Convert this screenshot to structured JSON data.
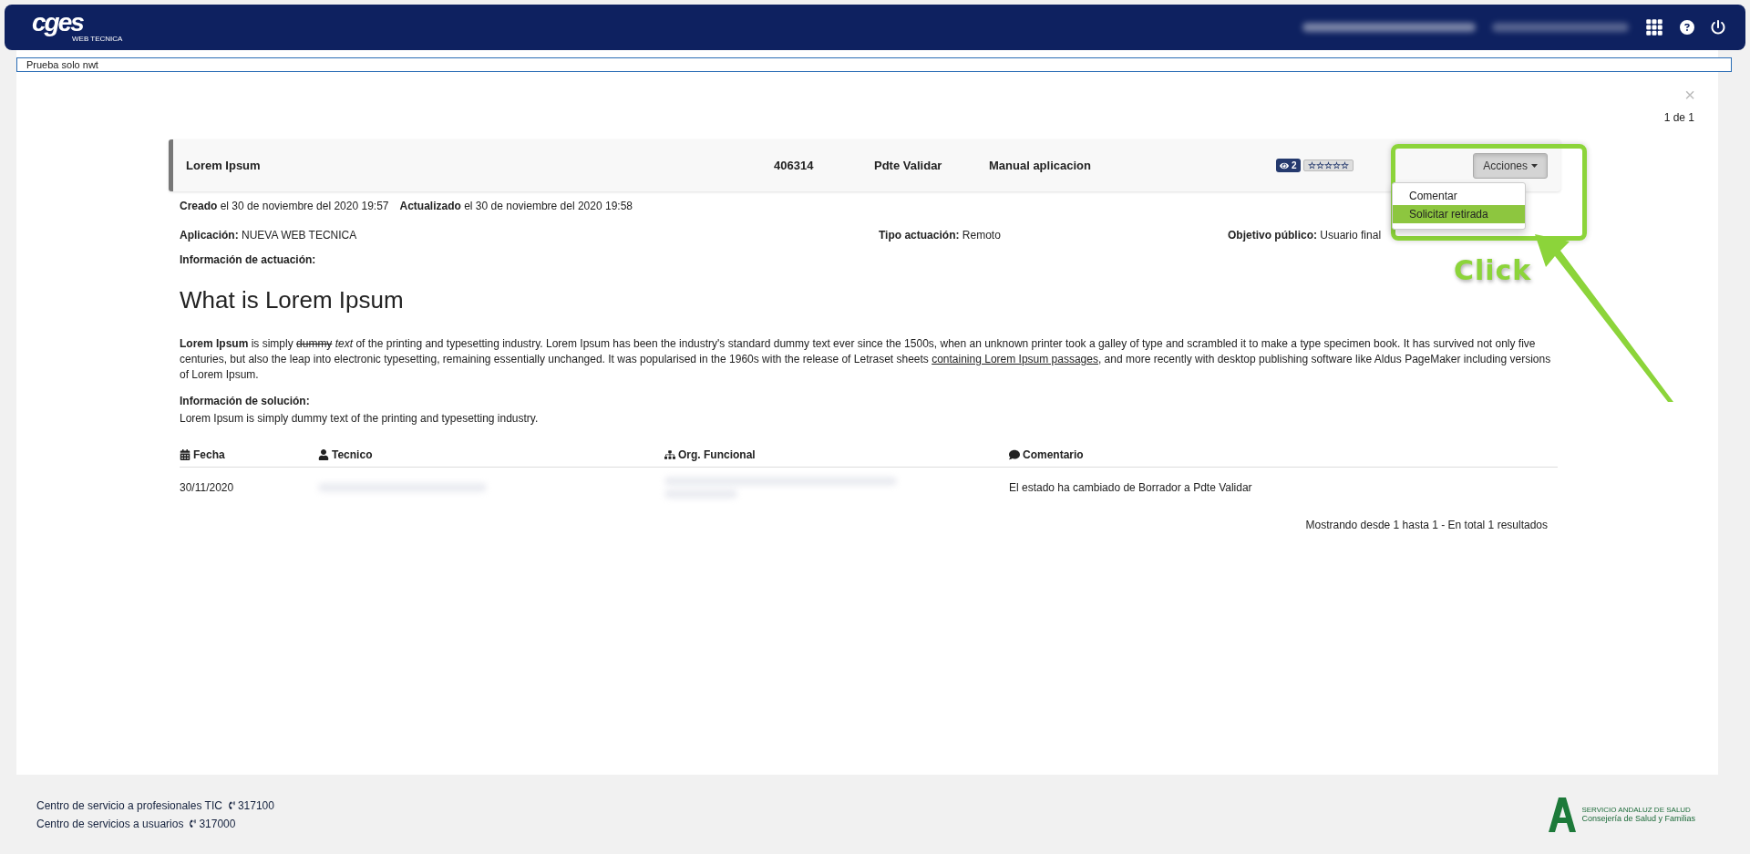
{
  "header": {
    "logo": {
      "name": "cges",
      "subtitle": "WEB TECNICA"
    }
  },
  "notice": {
    "value": "Prueba solo nwt"
  },
  "panel": {
    "close": "×",
    "pager": "1 de 1"
  },
  "record": {
    "title": "Lorem Ipsum",
    "number": "406314",
    "status": "Pdte Validar",
    "type": "Manual aplicacion",
    "views": "2",
    "stars": 0,
    "actions": {
      "label": "Acciones",
      "expanded": true,
      "items": [
        {
          "label": "Comentar",
          "selected": false
        },
        {
          "label": "Solicitar retirada",
          "selected": true
        }
      ]
    }
  },
  "callout": {
    "label": "Click"
  },
  "dates": [
    {
      "label": "Creado",
      "value": "el 30 de noviembre del 2020 19:57"
    },
    {
      "label": "Actualizado",
      "value": "el 30 de noviembre del 2020 19:58"
    }
  ],
  "fields": [
    {
      "label": "Aplicación:",
      "value": "NUEVA WEB TECNICA"
    },
    {
      "label": "Tipo actuación:",
      "value": "Remoto"
    },
    {
      "label": "Objetivo público:",
      "value": "Usuario final"
    }
  ],
  "actuacion": {
    "label": "Información de actuación:",
    "heading": "What is Lorem Ipsum",
    "paragraph": [
      {
        "kind": "bold",
        "text": "Lorem Ipsum"
      },
      {
        "kind": "plain",
        "text": " is simply "
      },
      {
        "kind": "strike",
        "text": "dummy"
      },
      {
        "kind": "italic",
        "text": " text"
      },
      {
        "kind": "plain",
        "text": " of the printing and typesetting industry. Lorem Ipsum has been the industry's standard dummy text ever since the 1500s, when an unknown printer took a galley of type and scrambled it to make a type specimen book. It has survived not only five centuries, but also the leap into electronic typesetting, remaining essentially unchanged. It was popularised in the 1960s with the release of Letraset sheets "
      },
      {
        "kind": "link",
        "text": "containing Lorem Ipsum passages"
      },
      {
        "kind": "plain",
        "text": ", and more recently with desktop publishing software like Aldus PageMaker including versions of Lorem Ipsum."
      }
    ]
  },
  "solucion": {
    "label": "Información de solución:",
    "text": "Lorem Ipsum is simply dummy text of the printing and typesetting industry."
  },
  "table": {
    "columns": [
      {
        "label": "Fecha"
      },
      {
        "label": "Tecnico"
      },
      {
        "label": "Org. Funcional"
      },
      {
        "label": "Comentario"
      }
    ],
    "rows": [
      {
        "fecha": "30/11/2020",
        "comentario": "El estado ha cambiado de Borrador a Pdte Validar"
      }
    ],
    "summary": "Mostrando desde 1 hasta 1 - En total 1 resultados"
  },
  "footer": {
    "contacts": [
      {
        "label": "Centro de servicio a profesionales TIC",
        "phone": "317100"
      },
      {
        "label": "Centro de servicios a usuarios",
        "phone": "317000"
      }
    ],
    "brand": {
      "line1": "SERVICIO ANDALUZ DE SALUD",
      "line2": "Consejería de Salud y Familias"
    }
  }
}
